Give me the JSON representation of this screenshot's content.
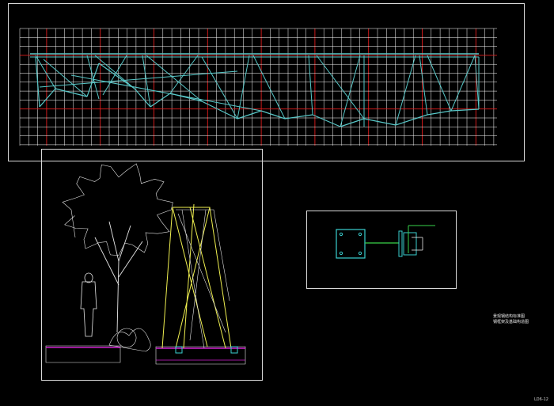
{
  "drawing": {
    "background": "#000000",
    "colors": {
      "frame": "#d8d8d8",
      "grid_minor": "#ffffff",
      "grid_major": "#e01e1e",
      "truss": "#58c8c8",
      "yellow": "#f0f050",
      "magenta": "#d020d0",
      "green": "#39d24a",
      "cyan": "#3ad0d0",
      "white": "#e8e8e8"
    },
    "panels": [
      {
        "name": "plan-grid-panel"
      },
      {
        "name": "elevation-panel"
      },
      {
        "name": "connection-detail-panel"
      }
    ],
    "icons": [
      "tree-figure",
      "person-silhouette",
      "shrub",
      "steel-frame",
      "base-plate",
      "bracket"
    ]
  },
  "notes": {
    "line1": "景观钢结构标准图",
    "line2": "钢框架及基础构造图"
  },
  "drawing_code": "LD6-12"
}
